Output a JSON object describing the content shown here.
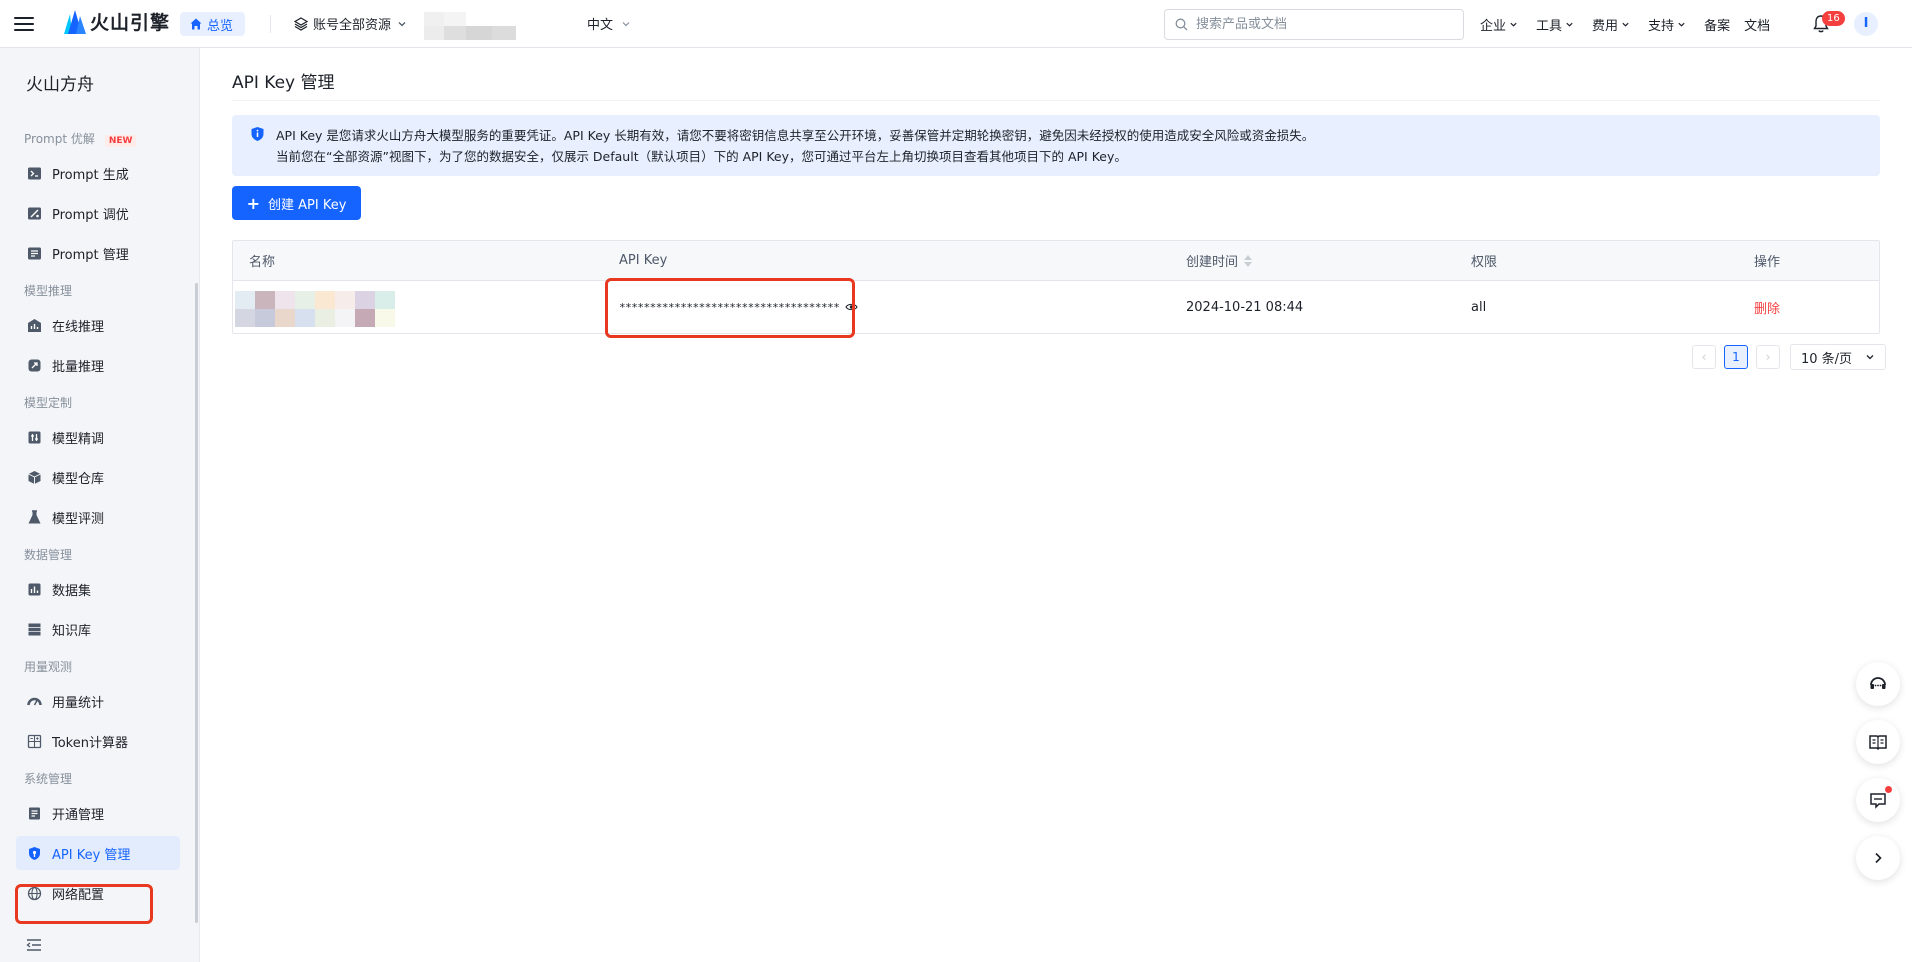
{
  "topbar": {
    "brand": "火山引擎",
    "overview": "总览",
    "account": "账号全部资源",
    "language": "中文",
    "search_placeholder": "搜索产品或文档",
    "nav": [
      "企业",
      "工具",
      "费用",
      "支持",
      "备案",
      "文档"
    ],
    "nav_dropdown": [
      true,
      true,
      true,
      true,
      false,
      false
    ],
    "notification_count": "16",
    "avatar_letter": "I"
  },
  "sidebar": {
    "title": "火山方舟",
    "groups": [
      {
        "label": "Prompt 优解",
        "badge": "NEW"
      },
      {
        "label": "模型推理"
      },
      {
        "label": "模型定制"
      },
      {
        "label": "数据管理"
      },
      {
        "label": "用量观测"
      },
      {
        "label": "系统管理"
      }
    ],
    "items": [
      {
        "label": "Prompt 生成",
        "icon": "prompt-generate-icon"
      },
      {
        "label": "Prompt 调优",
        "icon": "prompt-tune-icon"
      },
      {
        "label": "Prompt 管理",
        "icon": "prompt-manage-icon"
      },
      {
        "label": "在线推理",
        "icon": "online-inference-icon"
      },
      {
        "label": "批量推理",
        "icon": "batch-inference-icon"
      },
      {
        "label": "模型精调",
        "icon": "fine-tune-icon"
      },
      {
        "label": "模型仓库",
        "icon": "model-repo-icon"
      },
      {
        "label": "模型评测",
        "icon": "model-eval-icon"
      },
      {
        "label": "数据集",
        "icon": "dataset-icon"
      },
      {
        "label": "知识库",
        "icon": "knowledge-base-icon"
      },
      {
        "label": "用量统计",
        "icon": "usage-stats-icon"
      },
      {
        "label": "Token计算器",
        "icon": "token-calculator-icon"
      },
      {
        "label": "开通管理",
        "icon": "activation-icon"
      },
      {
        "label": "API Key 管理",
        "icon": "shield-key-icon",
        "active": true
      },
      {
        "label": "网络配置",
        "icon": "network-icon"
      }
    ]
  },
  "main": {
    "title": "API Key 管理",
    "alert_line1": "API Key 是您请求火山方舟大模型服务的重要凭证。API Key 长期有效，请您不要将密钥信息共享至公开环境，妥善保管并定期轮换密钥，避免因未经授权的使用造成安全风险或资金损失。",
    "alert_line2": "当前您在“全部资源”视图下，为了您的数据安全，仅展示 Default（默认项目）下的 API Key，您可通过平台左上角切换项目查看其他项目下的 API Key。",
    "create_button": "创建 API Key",
    "table": {
      "columns": [
        "名称",
        "API Key",
        "创建时间",
        "权限",
        "操作"
      ],
      "rows": [
        {
          "name": "",
          "api_key": "************************************",
          "created": "2024-10-21 08:44",
          "permission": "all",
          "action": "删除"
        }
      ]
    },
    "pagination": {
      "prev": "‹",
      "current": "1",
      "next": "›",
      "page_size": "10 条/页"
    }
  },
  "colors": {
    "primary": "#1664ff",
    "danger": "#f53f3f",
    "highlight": "#e8381f",
    "alert_bg": "#e8f0ff"
  }
}
